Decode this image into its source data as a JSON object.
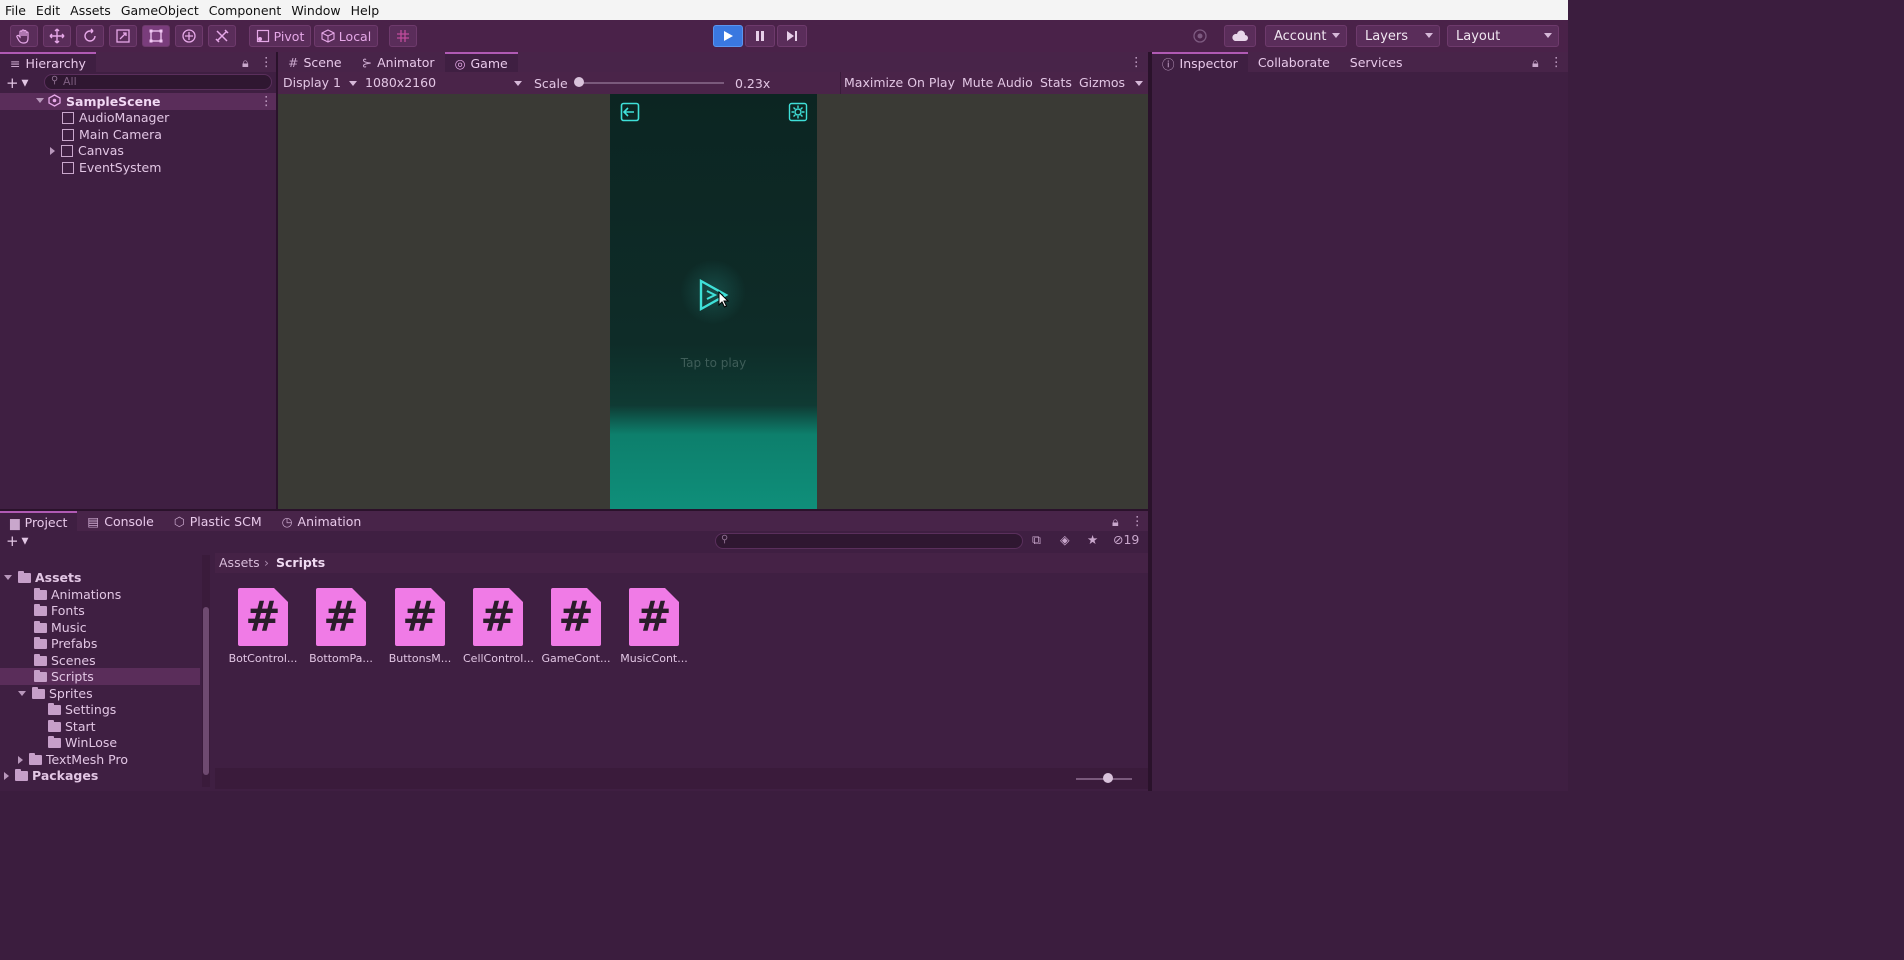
{
  "menu": [
    "File",
    "Edit",
    "Assets",
    "GameObject",
    "Component",
    "Window",
    "Help"
  ],
  "toolbar": {
    "tools": [
      "hand-tool-icon",
      "move-tool-icon",
      "rotate-tool-icon",
      "scale-tool-icon",
      "rect-tool-icon",
      "transform-tool-icon",
      "custom-tool-icon"
    ],
    "pivot_label": "Pivot",
    "local_label": "Local",
    "account_label": "Account",
    "layers_label": "Layers",
    "layout_label": "Layout"
  },
  "hierarchy": {
    "tab_label": "Hierarchy",
    "search_placeholder": "All",
    "scene": "SampleScene",
    "items": [
      "AudioManager",
      "Main Camera",
      "Canvas",
      "EventSystem"
    ]
  },
  "center_tabs": [
    "Scene",
    "Animator",
    "Game"
  ],
  "game_bar": {
    "display": "Display 1",
    "resolution": "1080x2160",
    "scale_label": "Scale",
    "scale_value": "0.23x",
    "maximize": "Maximize On Play",
    "mute": "Mute Audio",
    "stats": "Stats",
    "gizmos": "Gizmos"
  },
  "game_view": {
    "tap_text": "Tap to play"
  },
  "inspector_tabs": [
    "Inspector",
    "Collaborate",
    "Services"
  ],
  "bottom_tabs": [
    "Project",
    "Console",
    "Plastic SCM",
    "Animation"
  ],
  "project": {
    "hidden_count": "19",
    "breadcrumb": [
      "Assets",
      "Scripts"
    ],
    "tree": [
      {
        "label": "Assets",
        "level": 0,
        "open": true,
        "bold": true
      },
      {
        "label": "Animations",
        "level": 1
      },
      {
        "label": "Fonts",
        "level": 1
      },
      {
        "label": "Music",
        "level": 1
      },
      {
        "label": "Prefabs",
        "level": 1
      },
      {
        "label": "Scenes",
        "level": 1
      },
      {
        "label": "Scripts",
        "level": 1,
        "selected": true
      },
      {
        "label": "Sprites",
        "level": 1,
        "open": true
      },
      {
        "label": "Settings",
        "level": 2
      },
      {
        "label": "Start",
        "level": 2
      },
      {
        "label": "WinLose",
        "level": 2
      },
      {
        "label": "TextMesh Pro",
        "level": 1,
        "closed": true
      },
      {
        "label": "Packages",
        "level": 0,
        "closed": true,
        "bold": true
      }
    ],
    "scripts": [
      "BotControl...",
      "BottomPa...",
      "ButtonsM...",
      "CellControl...",
      "GameCont...",
      "MusicCont..."
    ]
  },
  "colors": {
    "accent_play": "#3a78e0",
    "script_icon": "#f07be6",
    "game_bg": "#3a3a35",
    "game_phone_top": "#0d2a26",
    "game_phone_bottom": "#0f8f7a",
    "glyph_cyan": "#3fe0d8"
  }
}
